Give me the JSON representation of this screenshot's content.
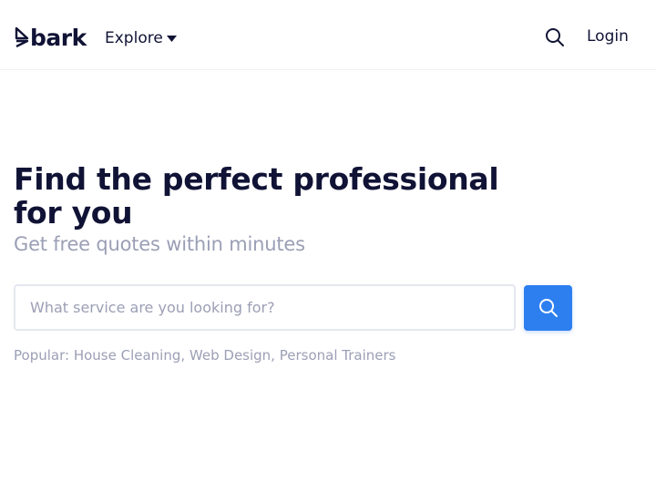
{
  "header": {
    "logo_text": "bark",
    "explore_label": "Explore",
    "login_label": "Login"
  },
  "hero": {
    "title": "Find the perfect professional for you",
    "subtitle": "Get free quotes within minutes"
  },
  "search": {
    "placeholder": "What service are you looking for?",
    "value": ""
  },
  "popular": {
    "label": "Popular:",
    "items": [
      "House Cleaning,",
      "Web Design,",
      "Personal Trainers"
    ]
  },
  "colors": {
    "brand_dark": "#101335",
    "accent_blue": "#2d7ff0",
    "muted_text": "#9b9fb5",
    "border": "#e6e8ef"
  },
  "icons": [
    "bark-logo-icon",
    "caret-down-icon",
    "search-icon"
  ]
}
